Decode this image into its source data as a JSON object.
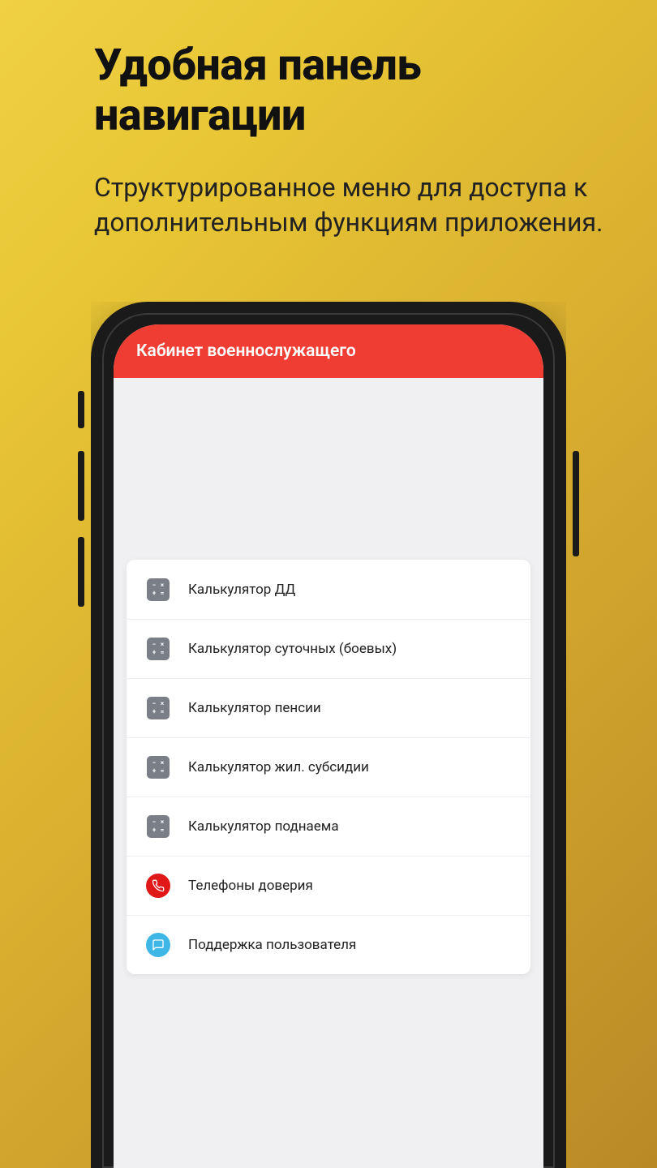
{
  "promo": {
    "heading": "Удобная панель навигации",
    "sub": "Структурированное меню для доступа к дополнительным функциям приложения."
  },
  "app": {
    "header_title": "Кабинет военнослужащего"
  },
  "menu": {
    "items": [
      {
        "label": "Калькулятор ДД",
        "icon": "calculator"
      },
      {
        "label": "Калькулятор суточных (боевых)",
        "icon": "calculator"
      },
      {
        "label": "Калькулятор пенсии",
        "icon": "calculator"
      },
      {
        "label": "Калькулятор жил. субсидии",
        "icon": "calculator"
      },
      {
        "label": "Калькулятор поднаема",
        "icon": "calculator"
      },
      {
        "label": "Телефоны доверия",
        "icon": "phone"
      },
      {
        "label": "Поддержка пользователя",
        "icon": "support"
      }
    ]
  }
}
